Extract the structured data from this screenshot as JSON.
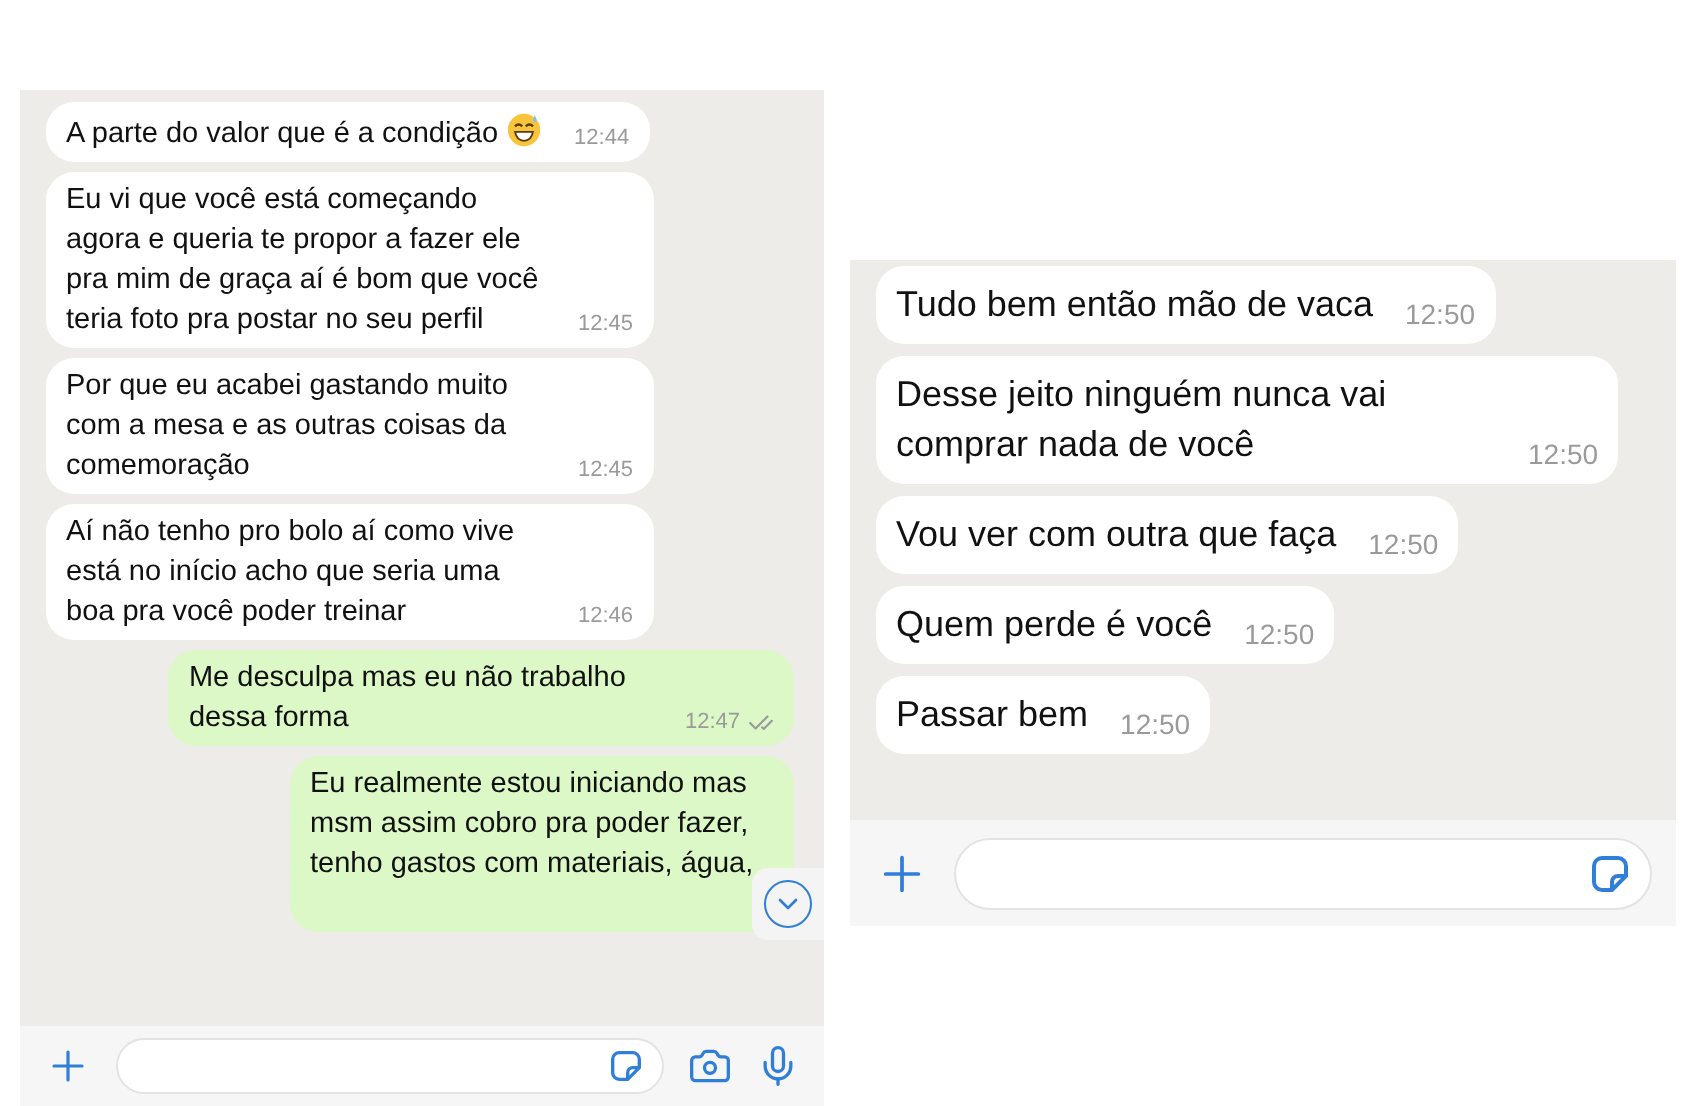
{
  "left_chat": {
    "messages": [
      {
        "kind": "incoming",
        "text": "A parte do valor que é a condição",
        "emoji": true,
        "time": "12:44"
      },
      {
        "kind": "incoming",
        "text": "Eu vi que você está começando agora e queria te propor a fazer ele pra mim de graça aí é bom que você teria foto pra postar no seu perfil",
        "time": "12:45"
      },
      {
        "kind": "incoming",
        "text": "Por que eu acabei gastando muito com a mesa e as outras coisas da comemoração",
        "time": "12:45"
      },
      {
        "kind": "incoming",
        "text": "Aí não tenho pro bolo aí como vive está no início acho que seria uma boa pra você poder treinar",
        "time": "12:46"
      },
      {
        "kind": "outgoing",
        "text": "Me desculpa mas eu não trabalho dessa forma",
        "time": "12:47",
        "read": true
      },
      {
        "kind": "outgoing",
        "text": "Eu realmente estou iniciando mas msm assim cobro pra poder fazer, tenho gastos com materiais, água,"
      }
    ]
  },
  "right_chat": {
    "messages": [
      {
        "kind": "incoming",
        "text": "Tudo bem então mão de vaca",
        "time": "12:50"
      },
      {
        "kind": "incoming",
        "text": "Desse jeito ninguém nunca vai comprar nada de você",
        "time": "12:50"
      },
      {
        "kind": "incoming",
        "text": "Vou ver com outra que faça",
        "time": "12:50"
      },
      {
        "kind": "incoming",
        "text": "Quem perde é você",
        "time": "12:50"
      },
      {
        "kind": "incoming",
        "text": "Passar bem",
        "time": "12:50"
      }
    ]
  }
}
